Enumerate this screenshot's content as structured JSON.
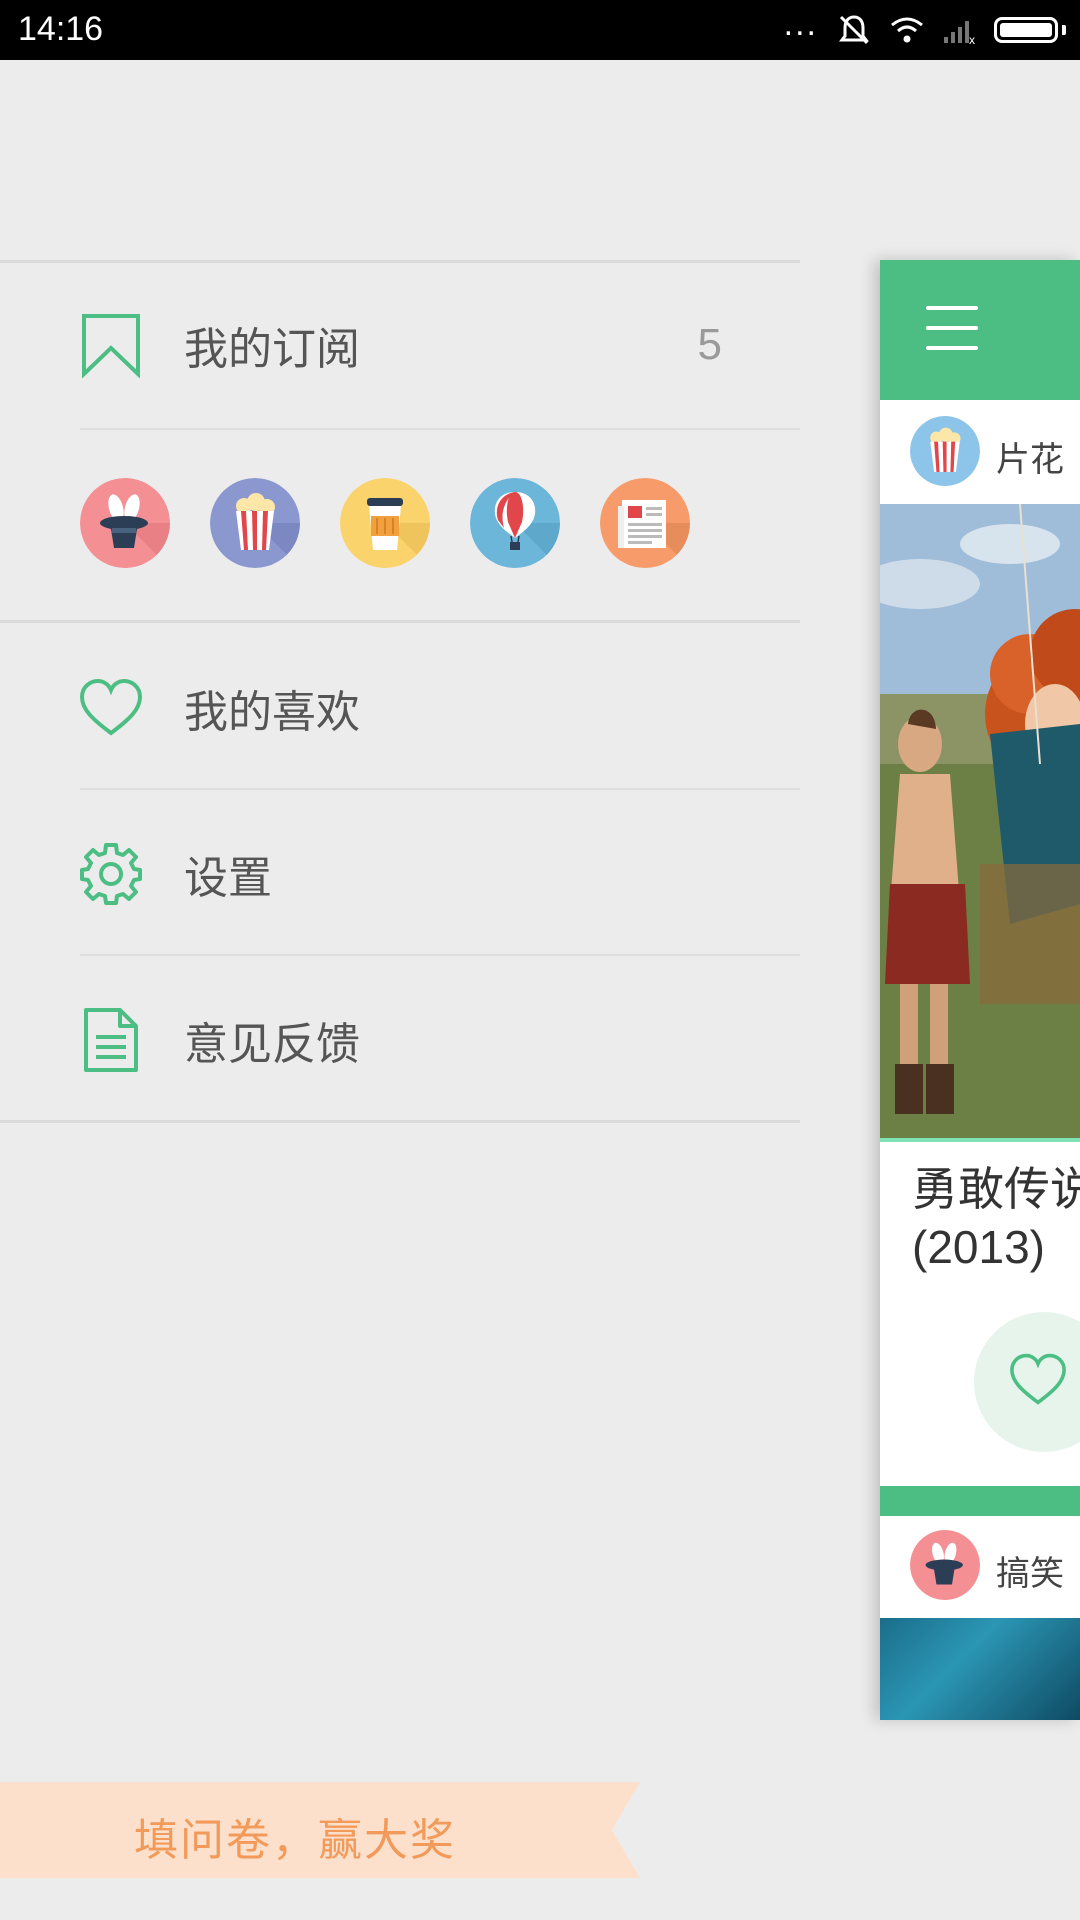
{
  "status_bar": {
    "time": "14:16",
    "icons": [
      "more-dots-icon",
      "mute-icon",
      "wifi-icon",
      "signal-icon",
      "battery-icon"
    ]
  },
  "drawer": {
    "subscriptions": {
      "label": "我的订阅",
      "count": "5",
      "icon": "bookmark-icon"
    },
    "subscription_icons": [
      "magic-hat-icon",
      "popcorn-icon",
      "coffee-cup-icon",
      "hot-air-balloon-icon",
      "newspaper-icon"
    ],
    "favorites": {
      "label": "我的喜欢",
      "icon": "heart-icon"
    },
    "settings": {
      "label": "设置",
      "icon": "gear-icon"
    },
    "feedback": {
      "label": "意见反馈",
      "icon": "document-icon"
    },
    "survey": {
      "label": "填问卷，赢大奖"
    }
  },
  "card": {
    "toolbar_icon": "hamburger-menu-icon",
    "feed_1": {
      "channel_name": "片花",
      "channel_icon": "popcorn-icon",
      "title_line1": "勇敢传说",
      "title_line2": "(2013)"
    },
    "feed_2": {
      "channel_name": "搞笑",
      "channel_icon": "magic-hat-icon"
    }
  },
  "colors": {
    "accent": "#4cbe84",
    "background": "#ececec",
    "survey_ribbon": "#fde0cc",
    "survey_text": "#f29a5a"
  }
}
